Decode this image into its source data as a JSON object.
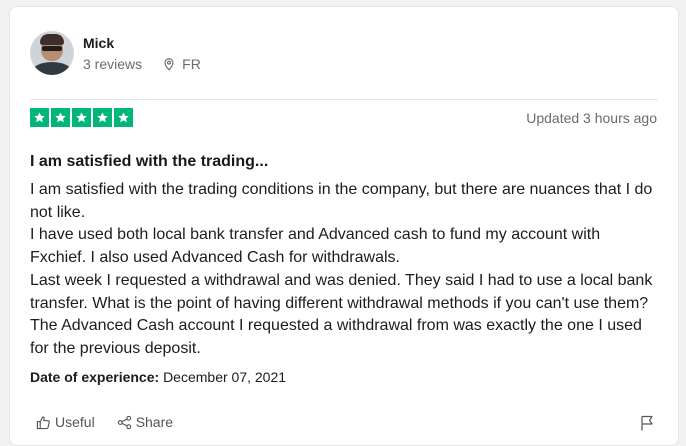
{
  "reviewer": {
    "name": "Mick",
    "reviews": "3 reviews",
    "country": "FR"
  },
  "review": {
    "rating": 5,
    "max_rating": 5,
    "updated": "Updated 3 hours ago",
    "title": "I am satisfied with the trading...",
    "paragraphs": [
      "I am satisfied with the trading conditions in the company, but there are nuances that I do not like.",
      "I have used both local bank transfer and Advanced cash to fund my account with Fxchief. I also used Advanced Cash for withdrawals.",
      "Last week I requested a withdrawal and was denied. They said I had to use a local bank transfer. What is the point of having different withdrawal methods if you can't use them? The Advanced Cash account I requested a withdrawal from was exactly the one I used for the previous deposit."
    ],
    "date_label": "Date of experience:",
    "date_value": "December 07, 2021"
  },
  "actions": {
    "useful_label": "Useful",
    "share_label": "Share"
  },
  "icons": {
    "location": "location-pin-icon",
    "star": "star-icon",
    "useful": "thumbs-up-icon",
    "share": "share-icon",
    "report": "flag-icon"
  },
  "colors": {
    "star_green": "#00b67a",
    "muted_text": "#6b6b6b"
  }
}
